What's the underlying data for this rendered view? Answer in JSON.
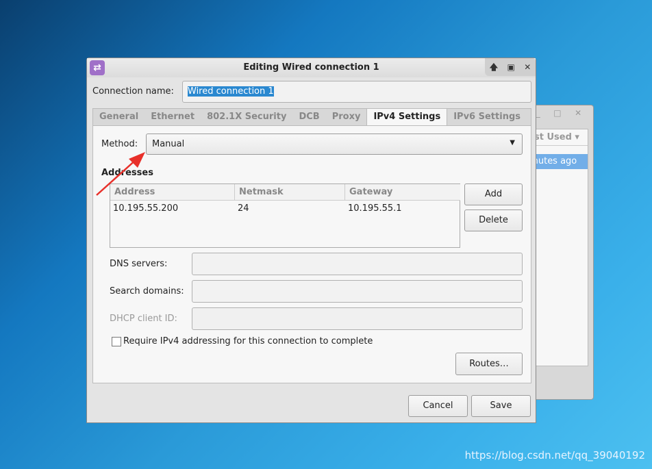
{
  "background_window": {
    "column_header": "st Used",
    "row_text": "inutes ago"
  },
  "dialog": {
    "title": "Editing Wired connection 1",
    "connection_name_label": "Connection name:",
    "connection_name_value": "Wired connection 1",
    "tabs": [
      "General",
      "Ethernet",
      "802.1X Security",
      "DCB",
      "Proxy",
      "IPv4 Settings",
      "IPv6 Settings"
    ],
    "active_tab": "IPv4 Settings",
    "method_label": "Method:",
    "method_value": "Manual",
    "addresses_heading": "Addresses",
    "columns": [
      "Address",
      "Netmask",
      "Gateway"
    ],
    "rows": [
      [
        "10.195.55.200",
        "24",
        "10.195.55.1"
      ]
    ],
    "add_label": "Add",
    "delete_label": "Delete",
    "dns_label": "DNS servers:",
    "search_label": "Search domains:",
    "dhcp_label": "DHCP client ID:",
    "require_label": "Require IPv4 addressing for this connection to complete",
    "require_checked": false,
    "routes_label": "Routes…",
    "cancel_label": "Cancel",
    "save_label": "Save"
  },
  "annotation_color": "#e8302a",
  "watermark": "https://blog.csdn.net/qq_39040192"
}
